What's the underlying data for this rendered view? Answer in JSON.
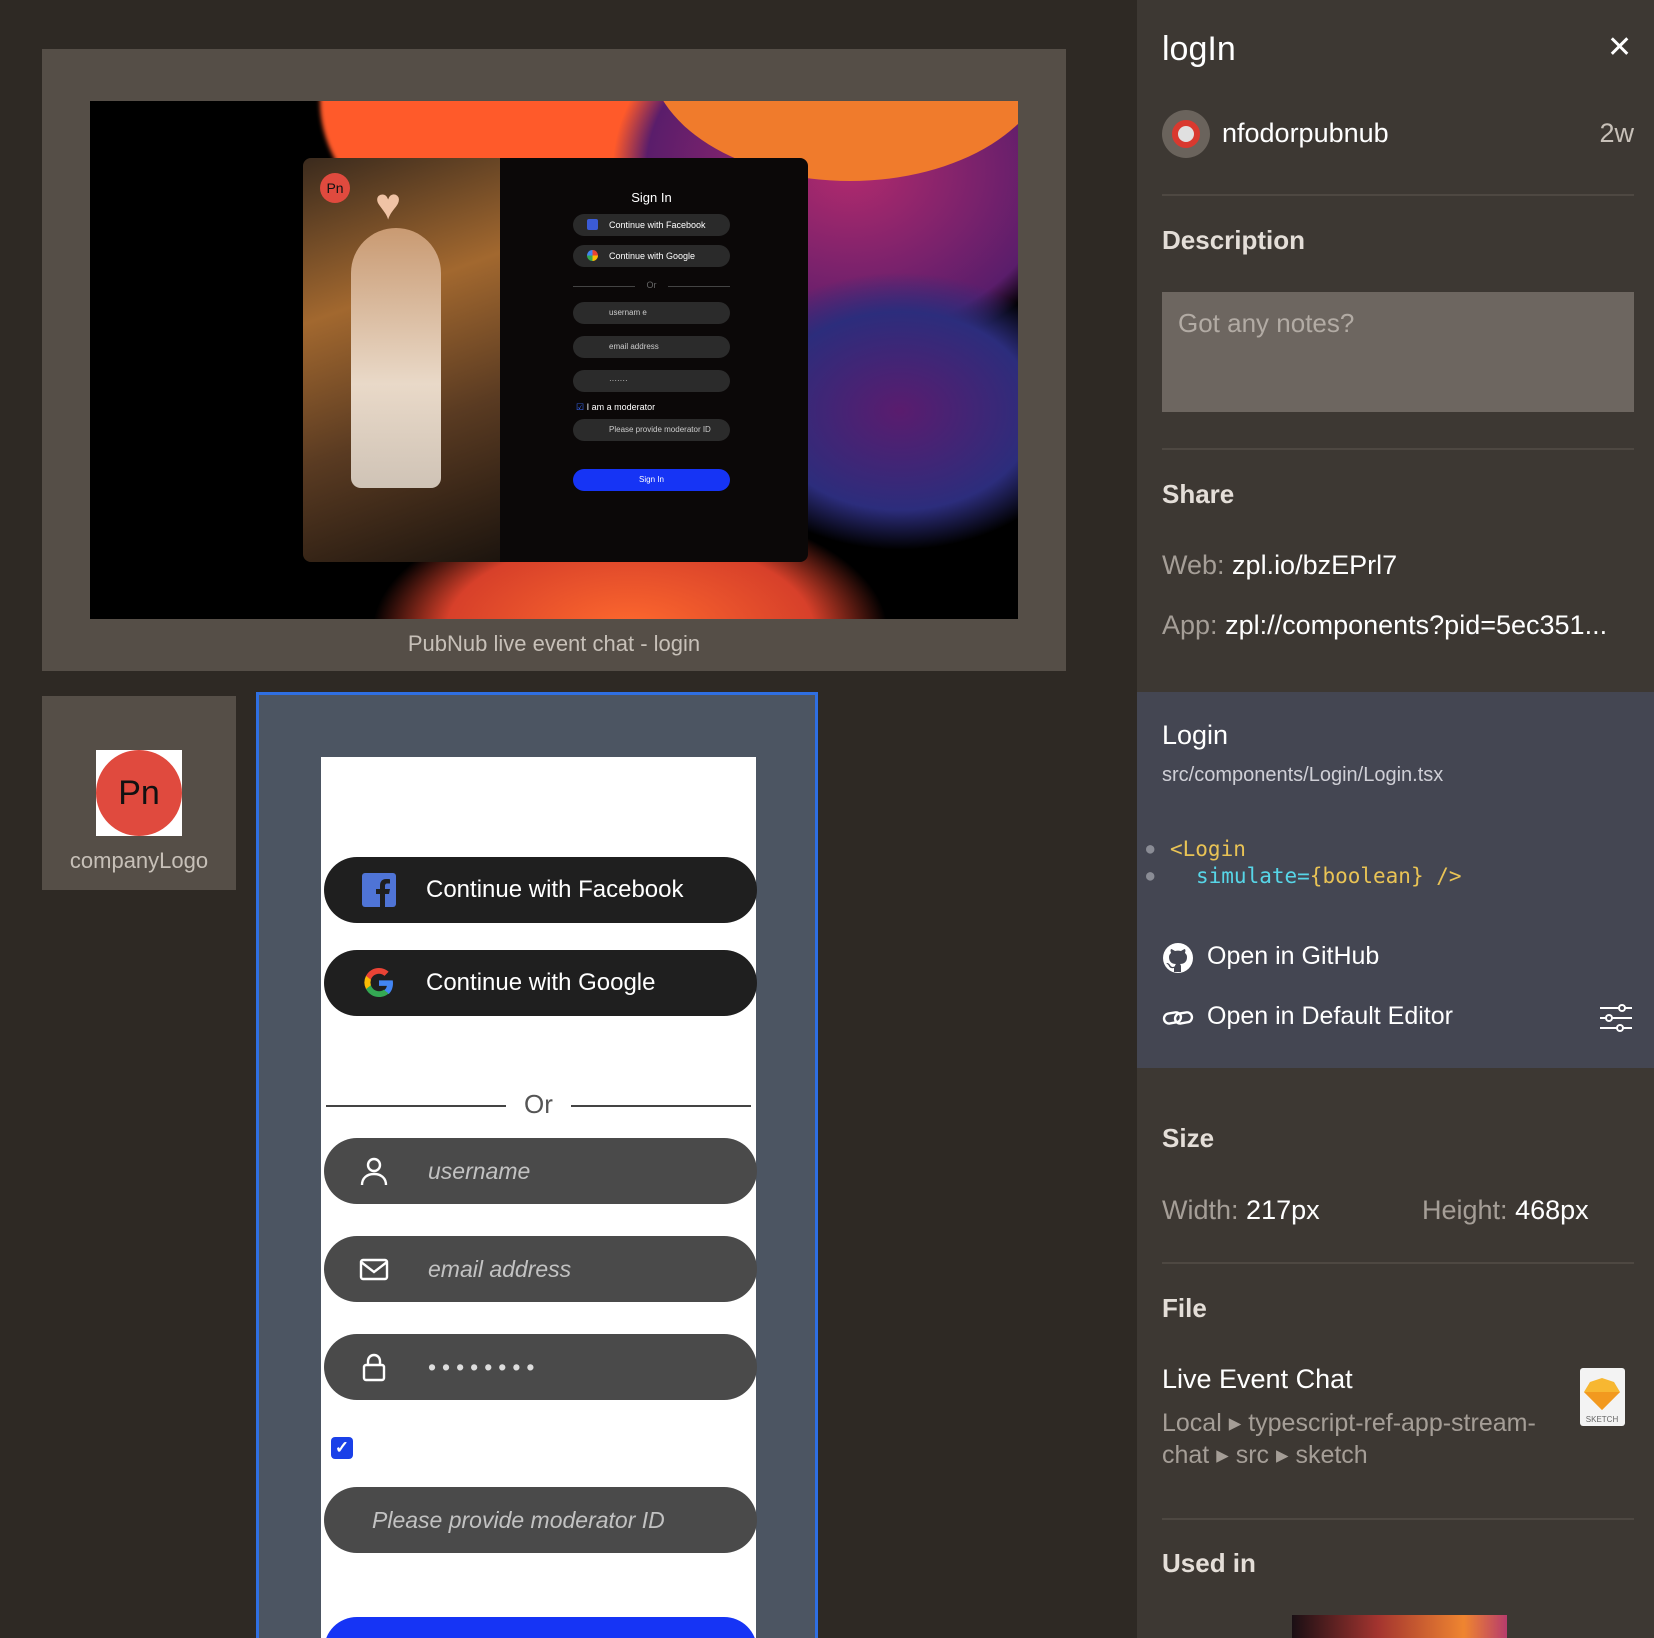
{
  "preview": {
    "caption": "PubNub live event chat - login",
    "logo_text": "Pn",
    "form": {
      "title": "Sign In",
      "facebook": "Continue with Facebook",
      "google": "Continue with Google",
      "or": "Or",
      "username": "usernam e",
      "email": "email address",
      "password": "·······",
      "moderator_check": "I am a moderator",
      "moderator_id": "Please provide moderator ID",
      "sign_in": "Sign In"
    }
  },
  "logo_card": {
    "logo_text": "Pn",
    "label": "companyLogo"
  },
  "login": {
    "facebook_label": "Continue with Facebook",
    "google_label": "Continue with Google",
    "or_label": "Or",
    "username_placeholder": "username",
    "email_placeholder": "email address",
    "password_value": "••••••••",
    "checkbox_mark": "✓",
    "moderator_placeholder": "Please provide moderator ID"
  },
  "side": {
    "title": "logIn",
    "close": "✕",
    "author": "nfodorpubnub",
    "time": "2w",
    "description_heading": "Description",
    "notes_placeholder": "Got any notes?",
    "share_heading": "Share",
    "web_label": "Web:",
    "web_value": "zpl.io/bzEPrl7",
    "app_label": "App:",
    "app_value": "zpl://components?pid=5ec351...",
    "component": {
      "name": "Login",
      "path": "src/components/Login/Login.tsx",
      "code_line1": "<Login",
      "code_attr": "simulate=",
      "code_val": "{boolean} />",
      "open_github": "Open in GitHub",
      "open_editor": "Open in Default Editor"
    },
    "size_heading": "Size",
    "width_label": "Width:",
    "width_value": "217px",
    "height_label": "Height:",
    "height_value": "468px",
    "file_heading": "File",
    "file_name": "Live Event Chat",
    "file_path": "Local ▸ typescript-ref-app-stream-chat ▸ src ▸ sketch",
    "sketch_label": "SKETCH",
    "used_in_heading": "Used in"
  },
  "colors": {
    "accent": "#2f6fe2",
    "brand_red": "#e04a3e",
    "sign_in_blue": "#1634f5"
  }
}
